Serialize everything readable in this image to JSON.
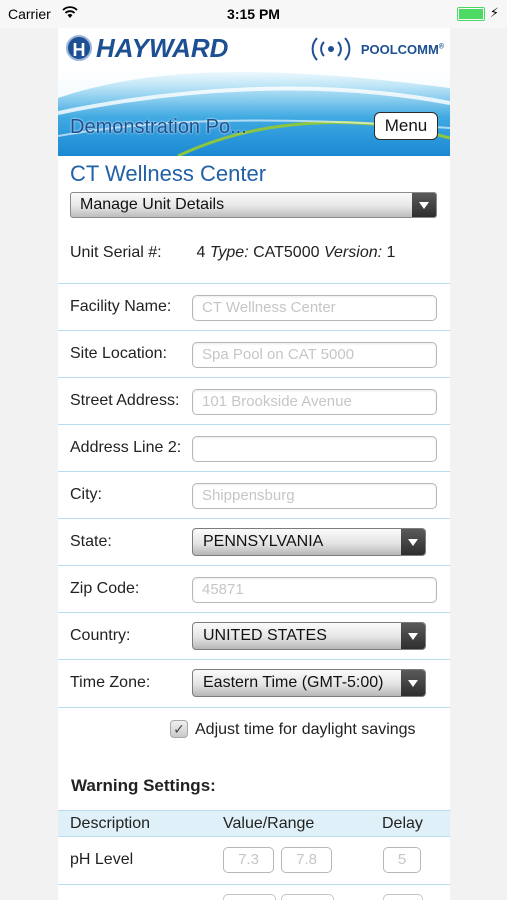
{
  "status_bar": {
    "carrier": "Carrier",
    "time": "3:15 PM",
    "battery_color": "#4cd964"
  },
  "header": {
    "brand_left": "HAYWARD",
    "brand_left_icon_letter": "H",
    "brand_right": "POOLCOMM",
    "brand_right_mark": "®",
    "site_title": "Demonstration Po...",
    "menu_label": "Menu"
  },
  "unit": {
    "title": "CT Wellness Center",
    "action_select": "Manage Unit Details",
    "serial_label": "Unit Serial #:",
    "serial_number": "4",
    "type_label": "Type:",
    "type_value": "CAT5000",
    "version_label": "Version:",
    "version_value": "1"
  },
  "form": {
    "facility_name": {
      "label": "Facility Name:",
      "placeholder": "CT Wellness Center"
    },
    "site_location": {
      "label": "Site Location:",
      "placeholder": "Spa Pool on CAT 5000"
    },
    "street_address": {
      "label": "Street Address:",
      "placeholder": "101 Brookside Avenue"
    },
    "address_line_2": {
      "label": "Address Line 2:",
      "placeholder": ""
    },
    "city": {
      "label": "City:",
      "placeholder": "Shippensburg"
    },
    "state": {
      "label": "State:",
      "value": "PENNSYLVANIA"
    },
    "zip_code": {
      "label": "Zip Code:",
      "placeholder": "45871"
    },
    "country": {
      "label": "Country:",
      "value": "UNITED STATES"
    },
    "time_zone": {
      "label": "Time Zone:",
      "value": "Eastern Time (GMT-5:00)"
    },
    "daylight_savings": {
      "label": "Adjust time for daylight savings",
      "checked": true
    }
  },
  "warning_settings": {
    "title": "Warning Settings:",
    "columns": [
      "Description",
      "Value/Range",
      "Delay"
    ],
    "rows": [
      {
        "description": "pH Level",
        "low": "7.3",
        "high": "7.8",
        "delay": "5"
      }
    ]
  },
  "colors": {
    "accent_blue": "#2161a6",
    "row_divider": "#b9dcef",
    "table_header_bg": "#dff0f8"
  }
}
